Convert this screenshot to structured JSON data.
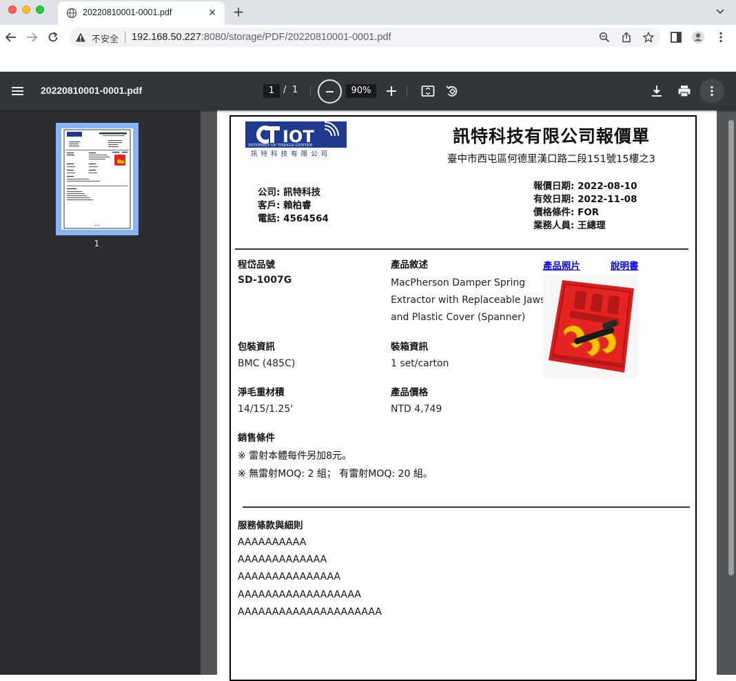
{
  "browser": {
    "tab_title": "20220810001-0001.pdf",
    "tab_close": "✕",
    "new_tab": "+",
    "insecure_label": "不安全",
    "url_host": "192.168.50.227",
    "url_path": ":8080/storage/PDF/20220810001-0001.pdf"
  },
  "viewer": {
    "file_name": "20220810001-0001.pdf",
    "current_page": "1",
    "page_separator": "/",
    "total_pages": "1",
    "zoom": "90%",
    "thumbnail_label": "1"
  },
  "document": {
    "logo_text": "IOT",
    "logo_sub": "INTERNET OF THINGS CENTER",
    "logo_cn": "訊 特 科 技 有 限 公 司",
    "title": "訊特科技有限公司報價單",
    "address": "臺中市西屯區何德里漢口路二段151號15樓之3",
    "left_info": [
      {
        "key": "公司:",
        "value": "訊特科技"
      },
      {
        "key": "客戶:",
        "value": "賴柏睿"
      },
      {
        "key": "電話:",
        "value": "4564564"
      }
    ],
    "right_info": [
      {
        "key": "報價日期:",
        "value": "2022-08-10"
      },
      {
        "key": "有效日期:",
        "value": "2022-11-08"
      },
      {
        "key": "價格條件:",
        "value": "FOR"
      },
      {
        "key": "業務人員:",
        "value": "王總理"
      }
    ],
    "item_no_label": "程岱品號",
    "item_no": "SD-1007G",
    "desc_label": "產品敘述",
    "desc_lines": [
      "MacPherson Damper Spring",
      "Extractor with Replaceable Jaws",
      "and Plastic Cover (Spanner)"
    ],
    "photo_link": "產品照片",
    "manual_link": "說明書",
    "packing_label": "包裝資訊",
    "packing": "BMC (485C)",
    "carton_label": "裝箱資訊",
    "carton": "1 set/carton",
    "weight_label": "淨毛重材積",
    "weight": "14/15/1.25'",
    "price_label": "產品價格",
    "price": "NTD 4,749",
    "sales_label": "銷售條件",
    "sales_lines": [
      "※ 雷射本體每件另加8元。",
      "※ 無雷射MOQ: 2 組； 有雷射MOQ: 20 組。"
    ],
    "terms_label": "服務條款與細則",
    "terms_lines": [
      "AAAAAAAAAA",
      "AAAAAAAAAAAAA",
      "AAAAAAAAAAAAAAA",
      "AAAAAAAAAAAAAAAAAA",
      "AAAAAAAAAAAAAAAAAAAAA"
    ]
  },
  "colors": {
    "chrome_tabbar": "#dee1e6",
    "viewer_toolbar": "#323639",
    "viewer_bg": "#525659",
    "sidebar_bg": "#2b2d30",
    "logo_blue": "#1f3a8f",
    "link_blue": "#0000ee",
    "product_red": "#e52421"
  }
}
